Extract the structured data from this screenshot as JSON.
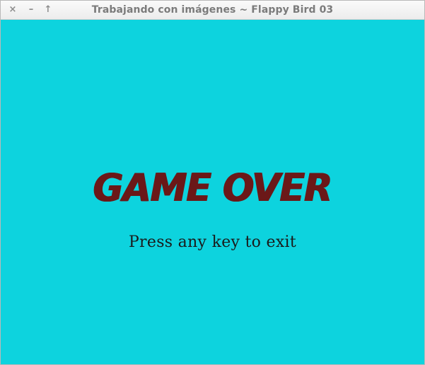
{
  "window": {
    "title": "Trabajando con imágenes ~ Flappy Bird 03",
    "close_glyph": "×",
    "minimize_glyph": "–",
    "maximize_glyph": "↑"
  },
  "game": {
    "headline": "GAME OVER",
    "prompt": "Press any key to exit",
    "colors": {
      "background": "#0dd3de",
      "headline": "#6b1818",
      "prompt": "#1a1a1a"
    }
  }
}
